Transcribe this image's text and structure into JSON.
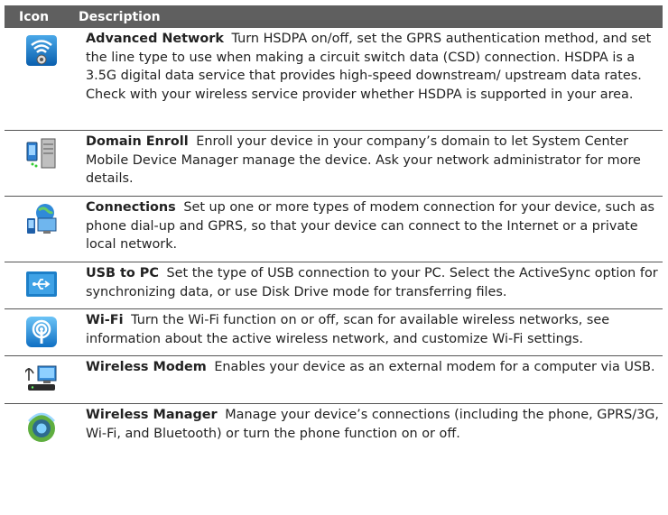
{
  "header": {
    "icon_label": "Icon",
    "description_label": "Description"
  },
  "rows": [
    {
      "icon": "advanced-network-icon",
      "title": "Advanced Network",
      "text": "Turn HSDPA on/off, set the GPRS authentication method, and set the line type to use when making a circuit switch data (CSD) connection. HSDPA is a 3.5G digital data service that provides high-speed downstream/ upstream data rates. Check with your wireless service provider whether HSDPA is supported in your area."
    },
    {
      "icon": "domain-enroll-icon",
      "title": "Domain Enroll",
      "text": "Enroll your device in your company’s domain to let System Center Mobile Device Manager manage the device. Ask your network administrator for more details."
    },
    {
      "icon": "connections-icon",
      "title": "Connections",
      "text": "Set up one or more types of modem connection for your device, such as phone dial-up and GPRS, so that your device can connect to the Internet or a private local network."
    },
    {
      "icon": "usb-to-pc-icon",
      "title": "USB to PC",
      "text": "Set the type of USB connection to your PC. Select the ActiveSync option for synchronizing data, or use Disk Drive mode for transferring files."
    },
    {
      "icon": "wifi-icon",
      "title": "Wi-Fi",
      "text": "Turn the Wi-Fi function on or off, scan for available wireless networks, see information about the active wireless network, and customize Wi-Fi settings."
    },
    {
      "icon": "wireless-modem-icon",
      "title": "Wireless Modem",
      "text": "Enables your device as an external modem for a computer via USB."
    },
    {
      "icon": "wireless-manager-icon",
      "title": "Wireless Manager",
      "text": "Manage your device’s connections (including the phone, GPRS/3G, Wi-Fi, and Bluetooth) or turn the phone function on or off."
    }
  ],
  "colors": {
    "header_bg": "#5f5f5f",
    "header_text": "#ffffff",
    "divider": "#555555"
  }
}
